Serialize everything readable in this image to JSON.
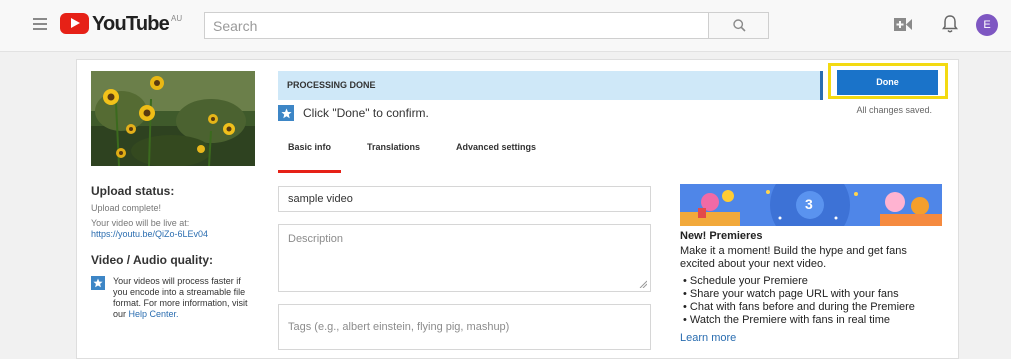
{
  "header": {
    "logo_text": "YouTube",
    "logo_region": "AU",
    "search_placeholder": "Search",
    "avatar_letter": "E"
  },
  "upload": {
    "status_title": "Upload status:",
    "status_text": "Upload complete!",
    "live_label": "Your video will be live at:",
    "live_url": "https://youtu.be/QiZo-6LEv04",
    "quality_title": "Video / Audio quality:",
    "quality_tip": "Your videos will process faster if you encode into a streamable file format. For more information, visit our",
    "help_center": "Help Center."
  },
  "processing": {
    "banner": "PROCESSING DONE",
    "confirm_text": "Click \"Done\" to confirm.",
    "done_label": "Done",
    "saved_text": "All changes saved."
  },
  "tabs": [
    {
      "label": "Basic info",
      "active": true
    },
    {
      "label": "Translations",
      "active": false
    },
    {
      "label": "Advanced settings",
      "active": false
    }
  ],
  "form": {
    "title_value": "sample video",
    "description_placeholder": "Description",
    "tags_placeholder": "Tags (e.g., albert einstein, flying pig, mashup)"
  },
  "promo": {
    "banner_number": "3",
    "title": "New! Premieres",
    "body": "Make it a moment! Build the hype and get fans excited about your next video.",
    "bullets": [
      "• Schedule your Premiere",
      "• Share your watch page URL with your fans",
      "• Chat with fans before and during the Premiere",
      "• Watch the Premiere with fans in real time"
    ],
    "learn_more": "Learn more"
  },
  "colors": {
    "accent_red": "#e62117",
    "done_blue": "#1a73c9",
    "highlight_yellow": "#f3da11",
    "processing_bg": "#cfe8f8"
  }
}
